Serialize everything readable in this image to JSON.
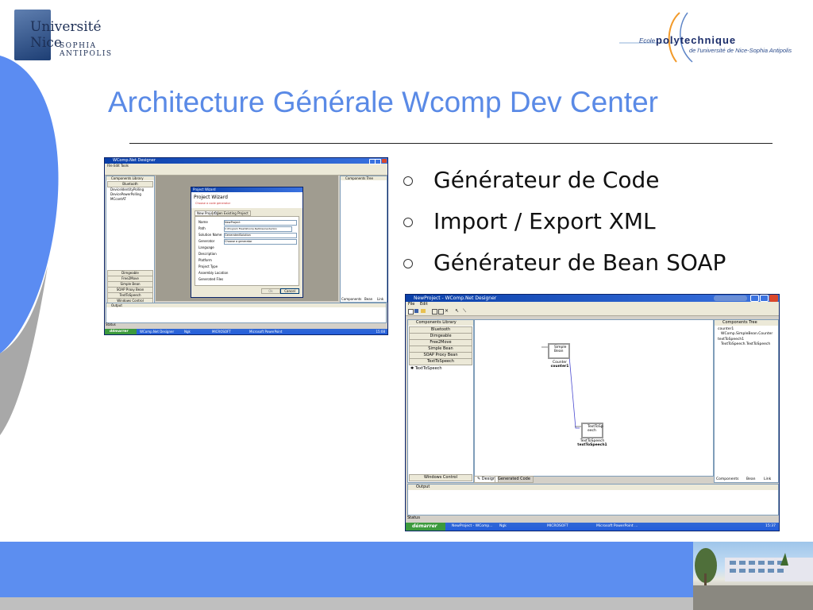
{
  "logos": {
    "university": {
      "line1": "Université",
      "line2": "Nice",
      "line3": "SOPHIA ANTIPOLIS"
    },
    "school": {
      "ecole": "Ecole",
      "name": "polytechnique",
      "subtitle": "de l'université de Nice-Sophia Antipolis"
    }
  },
  "title": "Architecture Générale Wcomp Dev Center",
  "bullets": [
    "Générateur de Code",
    "Import / Export XML",
    "Générateur de Bean SOAP"
  ],
  "screenshot1": {
    "title": "WComp.Net Designer",
    "menu": "File  Edit  Tools",
    "library_header": "Components Library",
    "library_tab": "Bluetooth",
    "library_items": [
      "DeviceIdentityPolling",
      "DevicePowerPolling",
      "MCcontAT"
    ],
    "library_buttons": [
      "Dimgeable",
      "Free2Move",
      "Simple Bean",
      "SOAP Proxy Bean",
      "TextToSpeech",
      "Windows Control"
    ],
    "tree_header": "Components Tree",
    "tree_tabs": [
      "Components",
      "Bean",
      "Link"
    ],
    "wizard": {
      "title": "Project Wizard",
      "heading": "Project Wizard",
      "subheading": "Choose a code generator",
      "tabs": [
        "New Project",
        "Open Existing Project"
      ],
      "fields": [
        {
          "label": "Name",
          "value": "NewProject"
        },
        {
          "label": "Path",
          "value": "C:\\Program Files\\WComp.Net\\DevCenter\\bin"
        },
        {
          "label": "Solution Name",
          "value": "GeneratedSolution"
        },
        {
          "label": "Generator",
          "value": "Choose a generator"
        },
        {
          "label": "Language",
          "value": ""
        },
        {
          "label": "Description",
          "value": ""
        },
        {
          "label": "Platform",
          "value": ""
        },
        {
          "label": "Project Type",
          "value": ""
        },
        {
          "label": "Assembly Location",
          "value": ""
        },
        {
          "label": "Generated Files",
          "value": ""
        }
      ],
      "buttons": [
        "Ok",
        "Cancel"
      ]
    },
    "output_label": "Output",
    "status": "Status",
    "taskbar": {
      "start": "démarrer",
      "items": [
        "WComp.Net Designer",
        "Ngk",
        "MICROSOFT",
        "Microsoft PowerPoint"
      ],
      "clock": "15:08"
    }
  },
  "screenshot2": {
    "title": "NewProject - WComp.Net Designer",
    "menu": [
      "File",
      "Edit"
    ],
    "library_header": "Components Library",
    "library_buttons": [
      "Bluetooth",
      "Dimgeable",
      "Free2Move",
      "Simple Bean",
      "SOAP Proxy Bean",
      "TextToSpeech"
    ],
    "library_items": [
      "TextToSpeech"
    ],
    "library_footer": "Windows Control",
    "canvas": {
      "bean1": {
        "label": "Simple Bean",
        "caption1": "Counter",
        "caption2": "counter1"
      },
      "bean2": {
        "label": "TextToSp eech",
        "caption1": "TextToSpeech",
        "caption2": "textToSpeech1"
      }
    },
    "canvas_tabs": [
      "Design",
      "Generated Code"
    ],
    "tree_header": "Components Tree",
    "tree_items": [
      "counter1",
      "WComp.SimpleBean.Counter",
      "textToSpeech1",
      "TextToSpeech.TextToSpeech"
    ],
    "tree_tabs": [
      "Components",
      "Bean",
      "Link"
    ],
    "output_label": "Output",
    "status": "Status",
    "taskbar": {
      "start": "démarrer",
      "items": [
        "NewProject - WComp...",
        "Ngk",
        "MICROSOFT",
        "Microsoft PowerPoint ..."
      ],
      "clock": "15:37"
    }
  },
  "colors": {
    "title": "#5a8ae6",
    "accent_band": "#5c8ef0",
    "deco": "#5b8cf2"
  }
}
